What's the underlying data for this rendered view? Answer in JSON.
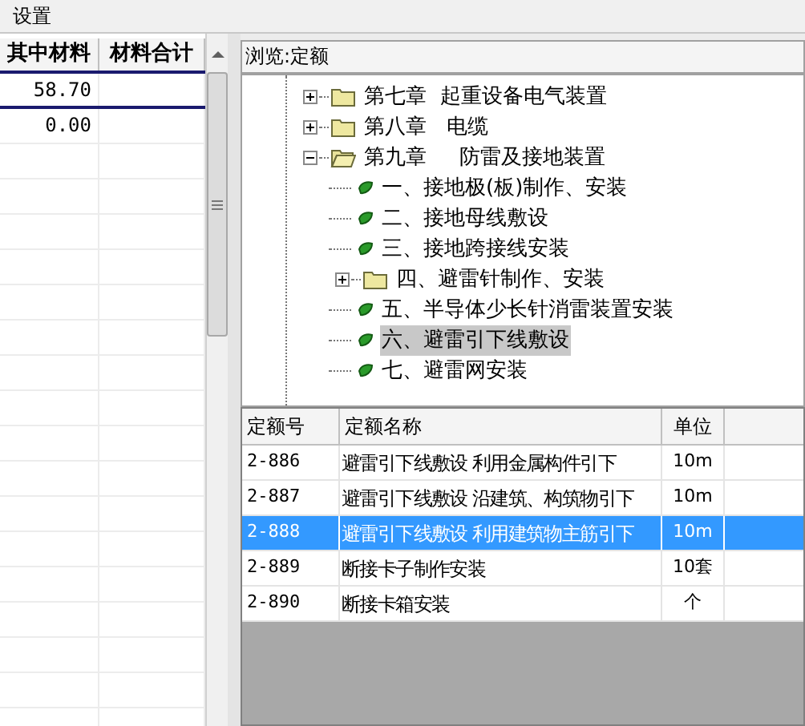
{
  "menu": [
    {
      "label": "设置"
    }
  ],
  "left_table": {
    "columns": [
      "其中材料",
      "材料合计"
    ],
    "rows": [
      {
        "cells": [
          "58.70",
          ""
        ]
      },
      {
        "cells": [
          "0.00",
          ""
        ]
      }
    ]
  },
  "browse_label": "浏览:定额",
  "tree": [
    {
      "label": "第七章  起重设备电气装置",
      "kind": "folder",
      "expanded": false,
      "selected": false
    },
    {
      "label": "第八章   电缆",
      "kind": "folder",
      "expanded": false,
      "selected": false
    },
    {
      "label": "第九章     防雷及接地装置",
      "kind": "folder",
      "expanded": true,
      "selected": false,
      "children": [
        {
          "label": "一、接地极(板)制作、安装",
          "kind": "leaf",
          "selected": false
        },
        {
          "label": "二、接地母线敷设",
          "kind": "leaf",
          "selected": false
        },
        {
          "label": "三、接地跨接线安装",
          "kind": "leaf",
          "selected": false
        },
        {
          "label": "四、避雷针制作、安装",
          "kind": "folder",
          "expanded": false,
          "selected": false
        },
        {
          "label": "五、半导体少长针消雷装置安装",
          "kind": "leaf",
          "selected": false
        },
        {
          "label": "六、避雷引下线敷设",
          "kind": "leaf",
          "selected": true
        },
        {
          "label": "七、避雷网安装",
          "kind": "leaf",
          "selected": false
        }
      ]
    }
  ],
  "quota_table": {
    "columns": [
      "定额号",
      "定额名称",
      "单位"
    ],
    "rows": [
      {
        "cells": [
          "2-886",
          "避雷引下线敷设 利用金属构件引下",
          "10m"
        ],
        "selected": false
      },
      {
        "cells": [
          "2-887",
          "避雷引下线敷设 沿建筑、构筑物引下",
          "10m"
        ],
        "selected": false
      },
      {
        "cells": [
          "2-888",
          "避雷引下线敷设 利用建筑物主筋引下",
          "10m"
        ],
        "selected": true
      },
      {
        "cells": [
          "2-889",
          "断接卡子制作安装",
          "10套"
        ],
        "selected": false
      },
      {
        "cells": [
          "2-890",
          "断接卡箱安装",
          "个"
        ],
        "selected": false
      }
    ]
  }
}
